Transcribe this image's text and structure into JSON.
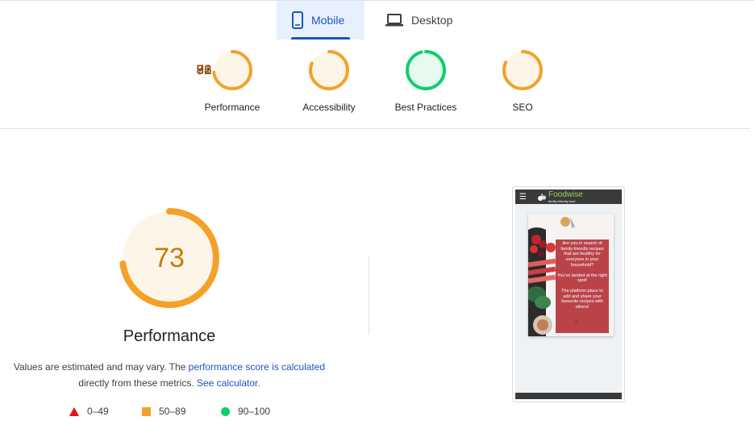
{
  "tabs": [
    {
      "label": "Mobile",
      "icon": "phone-icon",
      "selected": true
    },
    {
      "label": "Desktop",
      "icon": "laptop-icon",
      "selected": false
    }
  ],
  "categories": [
    {
      "score": "73",
      "label": "Performance",
      "value": 73,
      "status": "average",
      "color": "#f4a12a",
      "text_color": "#c33300"
    },
    {
      "score": "81",
      "label": "Accessibility",
      "value": 81,
      "status": "average",
      "color": "#f4a12a",
      "text_color": "#c33300"
    },
    {
      "score": "96",
      "label": "Best Practices",
      "value": 96,
      "status": "pass",
      "color": "#0cce6b",
      "text_color": "#018642"
    },
    {
      "score": "82",
      "label": "SEO",
      "value": 82,
      "status": "average",
      "color": "#f4a12a",
      "text_color": "#c33300"
    }
  ],
  "performance": {
    "score": "73",
    "value": 73,
    "title": "Performance",
    "desc_prefix": "Values are estimated and may vary. The ",
    "desc_link": "performance score is calculated",
    "desc_middle": " directly from these metrics. ",
    "desc_link2": "See calculator",
    "desc_suffix": "."
  },
  "legend": [
    {
      "range": "0–49",
      "shape": "triangle",
      "color": "#e8130d"
    },
    {
      "range": "50–89",
      "shape": "square",
      "color": "#f4a12a"
    },
    {
      "range": "90–100",
      "shape": "circle",
      "color": "#0cce6b"
    }
  ],
  "screenshot": {
    "brand": "Foodwise",
    "tagline": "family friendly food",
    "para1": "Are you in search of family-friendly recipes that are healthy for everyone in your household?",
    "para2": "You've landed at the right spot!",
    "para3": "The platform place to add and share your favourite recipes with others!"
  },
  "colors": {
    "accent": "#1a56c4",
    "average": "#f4a12a",
    "pass": "#0cce6b",
    "fail": "#e8130d"
  }
}
